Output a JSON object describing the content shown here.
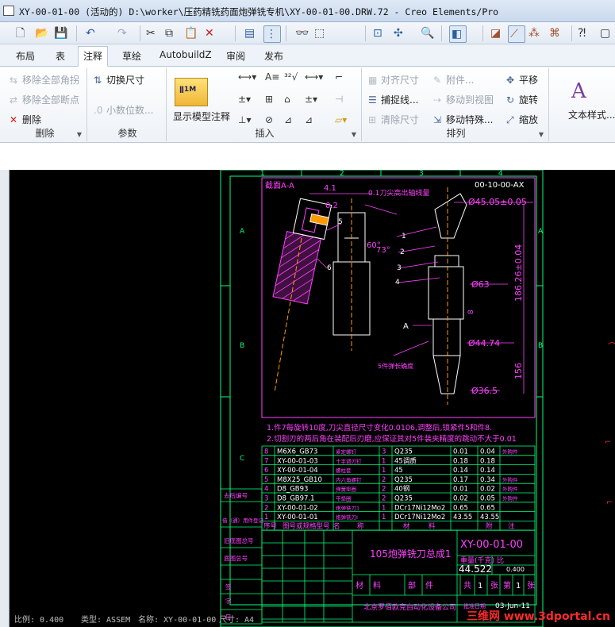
{
  "window": {
    "title": "XY-00-01-00 (活动的) D:\\worker\\压药精铣药面炮弹铣专机\\XY-00-01-00.DRW.72 - Creo Elements/Pro"
  },
  "toolbar": {
    "icons": [
      "new-icon",
      "open-icon",
      "save-icon",
      "undo-icon",
      "redo-icon",
      "cut-icon",
      "copy-icon",
      "paste-icon",
      "delete-icon",
      "layers-icon",
      "model-tree-icon",
      "binoculars-icon",
      "select-box-icon",
      "refit-icon",
      "zoom-icon",
      "display-style-icon",
      "help-icon"
    ]
  },
  "tabs": [
    "布局",
    "表",
    "注释",
    "草绘",
    "AutobuildZ",
    "审阅",
    "发布"
  ],
  "active_tab": "注释",
  "ribbon": {
    "delete_group": {
      "label": "删除",
      "items": [
        "移除全部角拐",
        "移除全部断点",
        "删除"
      ]
    },
    "params_group": {
      "label": "参数",
      "items": [
        "切换尺寸",
        "小数位数..."
      ]
    },
    "insert_group": {
      "label": "插入",
      "show_annotations": "显示模型注释"
    },
    "arrange_group": {
      "label": "排列",
      "items": [
        "对齐尺寸",
        "附件...",
        "平移",
        "捕捉线...",
        "移动到视图",
        "旋转",
        "清除尺寸",
        "移动特殊...",
        "缩放"
      ]
    },
    "text_style": "文本样式..."
  },
  "drawing": {
    "section": "截面A-A",
    "part_number": "00-10-00-AX",
    "dims": [
      "4.1",
      "0.1刀尖高出轴线量",
      "0.2",
      "60°",
      "73°",
      "Ø45.05±0.05",
      "186.26±0.04",
      "Ø63",
      "Ø44.74",
      "156",
      "Ø36.5",
      "8"
    ],
    "balloons": [
      "1",
      "2",
      "3",
      "4",
      "5",
      "6"
    ],
    "section_mark": "A",
    "note_spring": "5件弹长确度",
    "zone_rows": [
      "A",
      "B",
      "C"
    ],
    "zone_cols": [
      "1",
      "2",
      "3",
      "4"
    ],
    "notes": [
      "1.件7每旋转10度,刀尖直径尺寸变化0.0106,调整后,锁紧件5和件8.",
      "2.切割刃的两后角在装配后刃磨,应保证其对5件装夹精度的跳动不大于0.01"
    ],
    "bom_rows": [
      [
        "8",
        "M6X6_GB73",
        "紧定螺钉",
        "3",
        "Q235",
        "0.01",
        "0.04",
        "外购件"
      ],
      [
        "7",
        "XY-00-01-03",
        "十字调刃钉",
        "1",
        "45调质",
        "0.18",
        "0.18",
        ""
      ],
      [
        "6",
        "XY-00-01-04",
        "螺柱套",
        "1",
        "45",
        "0.14",
        "0.14",
        ""
      ],
      [
        "5",
        "M8X25_GB10",
        "内六角螺钉",
        "2",
        "Q235",
        "0.17",
        "0.34",
        "外购件"
      ],
      [
        "4",
        "D8_GB93",
        "弹簧垫圈",
        "2",
        "40钢",
        "0.01",
        "0.02",
        "外购件"
      ],
      [
        "3",
        "D8_GB97.1",
        "平垫圈",
        "2",
        "Q235",
        "0.02",
        "0.05",
        "外购件"
      ],
      [
        "2",
        "XY-00-01-02",
        "炮弹铣刀1",
        "1",
        "DCr17Ni12Mo2",
        "0.65",
        "0.65",
        ""
      ],
      [
        "1",
        "XY-00-01-01",
        "炮弹铣刀I",
        "1",
        "DCr17Ni12Mo2",
        "43.55",
        "43.55",
        ""
      ]
    ],
    "bom_header": [
      "序号",
      "图号或规格型号",
      "名",
      "称",
      "材",
      "料",
      "附",
      "注"
    ],
    "left_labels": [
      "去后编号",
      "借（通）用件登记",
      "旧底图总号",
      "底图总号",
      "签",
      "字",
      "日",
      "期"
    ],
    "title_block": {
      "name": "105炮弹铣刀总成1",
      "drawing_no": "XY-00-01-00",
      "weight_label": "重量(千克)",
      "scale_label": "比",
      "weight": "44.522",
      "scale": "0.400",
      "sheet_cells": [
        "材",
        "料",
        "部",
        "件",
        "共",
        "1",
        "张",
        "第",
        "1",
        "张"
      ],
      "company": "北京罗佰欧克自动化设备公司",
      "date_label": "批准日期",
      "date": "03-Jun-11"
    }
  },
  "status": {
    "scale": "比例: 0.400",
    "type": "类型: ASSEM",
    "name": "名称: XY-00-01-00",
    "size": "尺寸: A4"
  },
  "watermark": "三维网 www.3dportal.cn",
  "colors": {
    "drawing_bg": "#000000",
    "line_green": "#00ff7a",
    "dim_magenta": "#ff40ff",
    "part_white": "#ffffff",
    "center_orange": "#ff9a00",
    "watermark": "#ff2a2a"
  }
}
